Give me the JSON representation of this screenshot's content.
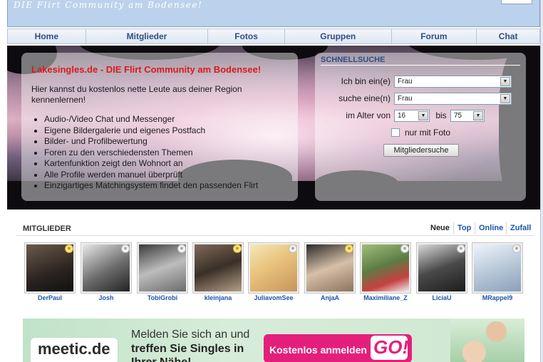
{
  "header": {
    "slogan": "DIE Flirt Community am Bodensee!"
  },
  "nav": {
    "items": [
      {
        "label": "Home"
      },
      {
        "label": "Mitglieder"
      },
      {
        "label": "Fotos"
      },
      {
        "label": "Gruppen"
      },
      {
        "label": "Forum"
      },
      {
        "label": "Chat"
      }
    ]
  },
  "hero": {
    "title": "Lakesingles.de - DIE Flirt Community am Bodensee!",
    "intro": "Hier kannst du kostenlos nette Leute aus deiner Region kennenlernen!",
    "features": [
      "Audio-/Video Chat und Messenger",
      "Eigene Bildergalerie und eigenes Postfach",
      "Bilder- und Profilbewertung",
      "Foren zu den verschiedensten Themen",
      "Kartenfunktion zeigt den Wohnort an",
      "Alle Profile werden manuel überprüft",
      "Einzigartiges Matchingsystem findet den passenden Flirt"
    ]
  },
  "quicksearch": {
    "title": "SCHNELLSUCHE",
    "i_am_label": "Ich bin ein(e)",
    "i_am_value": "Frau",
    "seeking_label": "suche eine(n)",
    "seeking_value": "Frau",
    "age_label": "im Alter von",
    "age_from": "16",
    "age_to_label": "bis",
    "age_to": "75",
    "photo_only_label": "nur mit Foto",
    "photo_only_checked": false,
    "submit_label": "Mitgliedersuche"
  },
  "members": {
    "title": "MITGLIEDER",
    "tabs": [
      {
        "label": "Neue",
        "active": true
      },
      {
        "label": "Top",
        "active": false
      },
      {
        "label": "Online",
        "active": false
      },
      {
        "label": "Zufall",
        "active": false
      }
    ],
    "list": [
      {
        "name": "DerPaul",
        "badge": "gold"
      },
      {
        "name": "Josh",
        "badge": "grey"
      },
      {
        "name": "TobiGrobi",
        "badge": "grey"
      },
      {
        "name": "kleinjana",
        "badge": "gold"
      },
      {
        "name": "JuliavomSee",
        "badge": "grey"
      },
      {
        "name": "AnjaA",
        "badge": "gold"
      },
      {
        "name": "Maximiliane_Z",
        "badge": "grey"
      },
      {
        "name": "LiciaU",
        "badge": "grey"
      },
      {
        "name": "MRappel9",
        "badge": "grey"
      }
    ]
  },
  "ad": {
    "logo": "meetic.de",
    "line1": "Melden Sie sich an und",
    "line2": "treffen Sie Singles in",
    "line3": "Ihrer Nähe!",
    "cta": "Kostenlos anmelden",
    "go": "GO!"
  },
  "colors": {
    "nav_text": "#2c4f86",
    "hero_title": "#d81b1b",
    "member_link": "#1d55a8",
    "ad_cta": "#e41f7b"
  }
}
